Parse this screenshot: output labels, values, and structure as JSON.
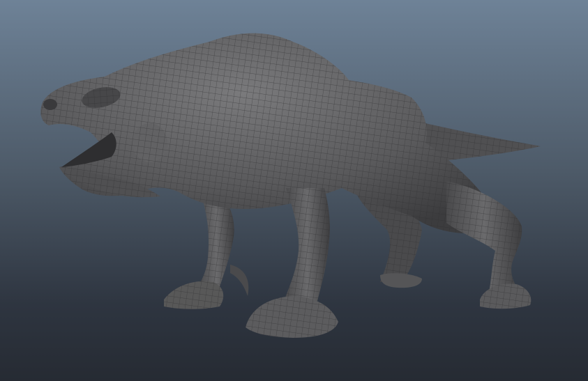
{
  "viewport": {
    "background_top": "#6e8297",
    "background_bottom": "#262b33",
    "model_color": "#5a5a5c",
    "wireframe_color": "#2f2f31"
  },
  "scene": {
    "object": "creature-model-wireframe-on-shaded",
    "text": ""
  }
}
